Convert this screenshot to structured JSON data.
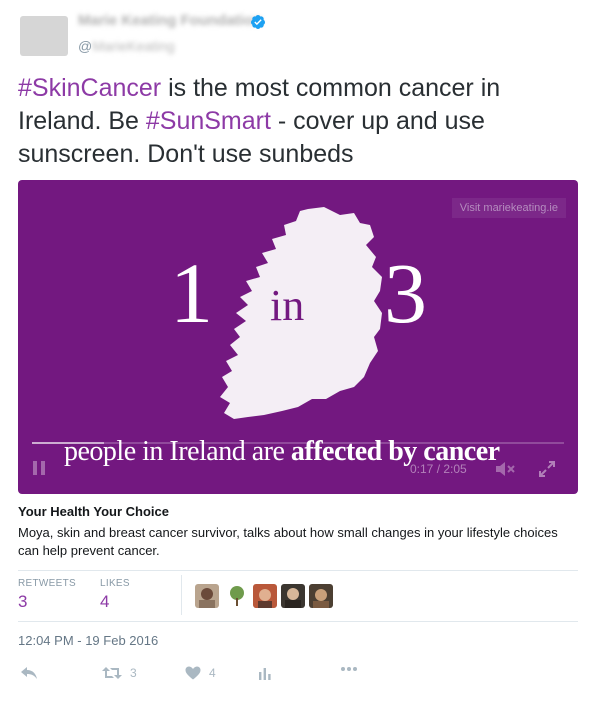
{
  "header": {
    "display_name": "Marie Keating Foundation",
    "handle_prefix": "@",
    "handle_hidden": "MarieKeating",
    "verified_icon": "verified-badge-icon",
    "colors": {
      "verified": "#1da1f2"
    }
  },
  "tweet": {
    "text_parts": [
      {
        "text": "#SkinCancer",
        "hashtag": true
      },
      {
        "text": " is the most common cancer in Ireland. Be ",
        "hashtag": false
      },
      {
        "text": "#SunSmart",
        "hashtag": true
      },
      {
        "text": " - cover up and use sunscreen. Don't use sunbeds",
        "hashtag": false
      }
    ],
    "colors": {
      "hashtag": "#8d3aa6",
      "text": "#292f33"
    }
  },
  "media": {
    "visit_label": "Visit mariekeating.ie",
    "number_left": "1",
    "number_right": "3",
    "word_in": "in",
    "caption_plain": "people in Ireland are ",
    "caption_bold": "affected by cancer",
    "time": "0:17 / 2:05",
    "progress": 0.136,
    "icons": {
      "play": "pause-icon",
      "mute": "mute-icon",
      "fullscreen": "fullscreen-icon",
      "map": "ireland-map"
    },
    "colors": {
      "background": "#731880"
    }
  },
  "card": {
    "title": "Your Health Your Choice",
    "description": "Moya, skin and breast cancer survivor, talks about how small changes in your lifestyle choices can help prevent cancer."
  },
  "stats": {
    "retweets_label": "RETWEETS",
    "retweets_value": "3",
    "likes_label": "LIKES",
    "likes_value": "4",
    "liker_avatars": [
      "avatar-1",
      "avatar-2",
      "avatar-3",
      "avatar-4",
      "avatar-5"
    ],
    "colors": {
      "value": "#8d3aa6"
    }
  },
  "meta": {
    "timestamp": "12:04 PM - 19 Feb 2016"
  },
  "actions": {
    "reply_icon": "reply-icon",
    "retweet_icon": "retweet-icon",
    "retweet_count": "3",
    "like_icon": "heart-icon",
    "like_count": "4",
    "analytics_icon": "analytics-icon",
    "more_icon": "more-icon"
  }
}
